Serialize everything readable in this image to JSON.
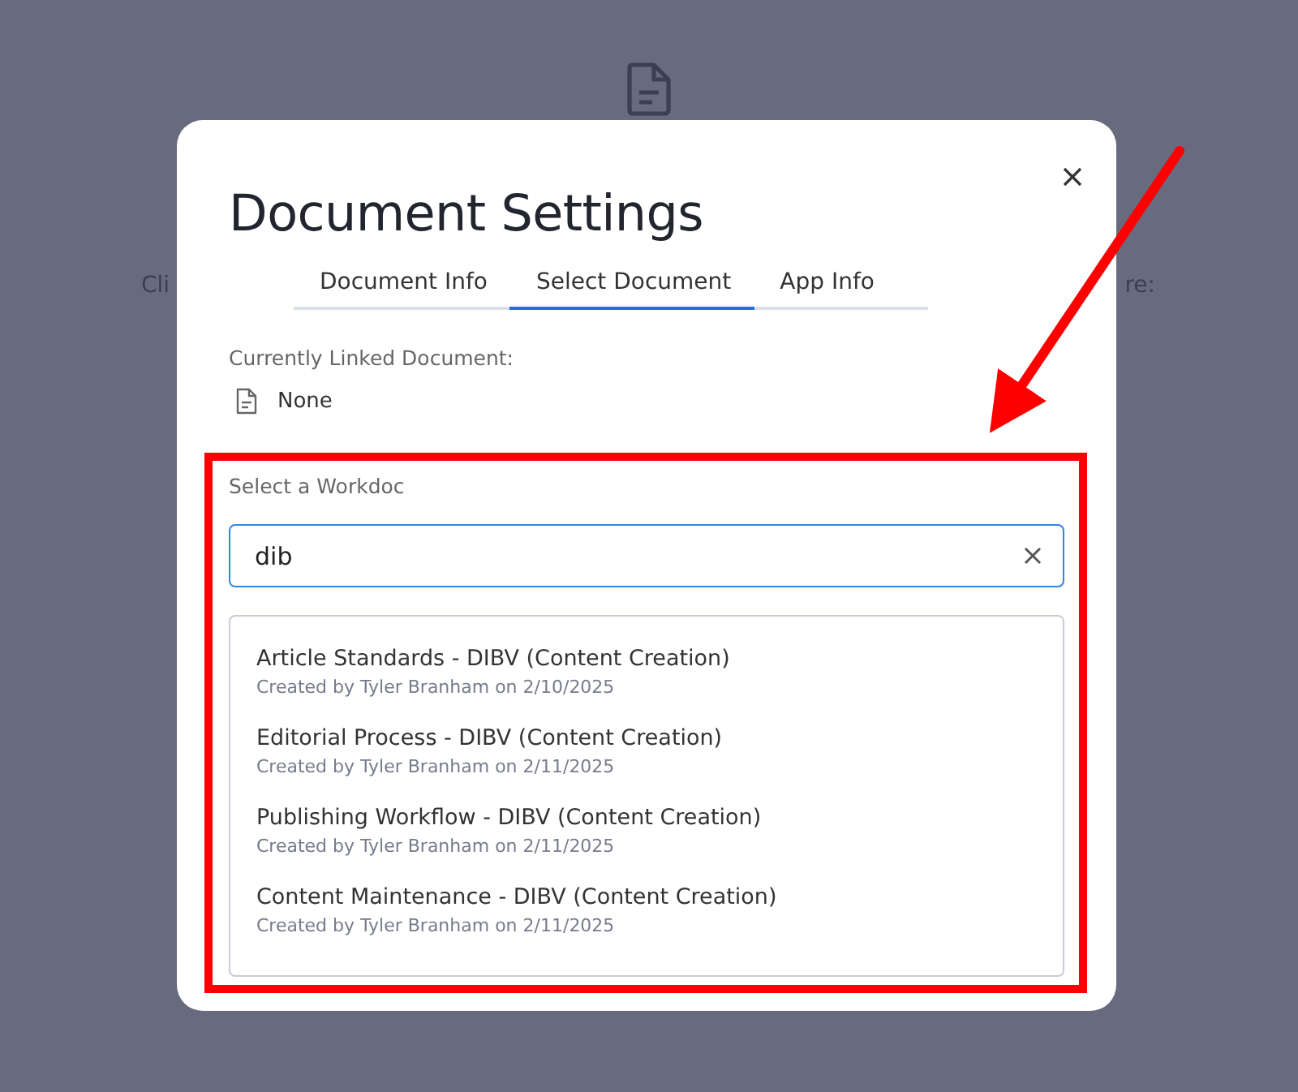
{
  "background": {
    "text_left": "Cli",
    "text_right": "re:"
  },
  "dialog": {
    "title": "Document Settings",
    "tabs": [
      {
        "label": "Document Info",
        "selected": false
      },
      {
        "label": "Select Document",
        "selected": true
      },
      {
        "label": "App Info",
        "selected": false
      }
    ],
    "linked_label": "Currently Linked Document:",
    "linked_value": "None",
    "select_label": "Select a Workdoc",
    "search": {
      "value": "dib"
    },
    "results": [
      {
        "title": "Article Standards - DIBV (Content Creation)",
        "subtitle": "Created by Tyler Branham on 2/10/2025"
      },
      {
        "title": "Editorial Process - DIBV (Content Creation)",
        "subtitle": "Created by Tyler Branham on 2/11/2025"
      },
      {
        "title": "Publishing Workflow - DIBV (Content Creation)",
        "subtitle": "Created by Tyler Branham on 2/11/2025"
      },
      {
        "title": "Content Maintenance - DIBV (Content Creation)",
        "subtitle": "Created by Tyler Branham on 2/11/2025"
      }
    ]
  }
}
